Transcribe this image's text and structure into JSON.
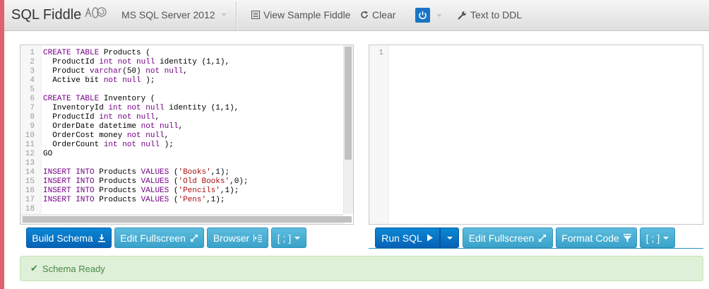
{
  "app": {
    "title": "SQL Fiddle"
  },
  "navbar": {
    "db_select": "MS SQL Server 2012",
    "view_sample": "View Sample Fiddle",
    "clear": "Clear",
    "text_to_ddl": "Text to DDL"
  },
  "schema_editor": {
    "lines": [
      {
        "n": "1",
        "parts": [
          [
            "kw",
            "CREATE TABLE "
          ],
          [
            "t",
            "Products ("
          ]
        ]
      },
      {
        "n": "2",
        "parts": [
          [
            "t",
            "  ProductId "
          ],
          [
            "kw",
            "int not null "
          ],
          [
            "t",
            "identity (1,1),"
          ]
        ]
      },
      {
        "n": "3",
        "parts": [
          [
            "t",
            "  Product "
          ],
          [
            "kw",
            "varchar"
          ],
          [
            "t",
            "(50) "
          ],
          [
            "kw",
            "not null"
          ],
          [
            "t",
            ","
          ]
        ]
      },
      {
        "n": "4",
        "parts": [
          [
            "t",
            "  Active bit "
          ],
          [
            "kw",
            "not null"
          ],
          [
            "t",
            " );"
          ]
        ]
      },
      {
        "n": "5",
        "parts": [
          [
            "t",
            ""
          ]
        ]
      },
      {
        "n": "6",
        "parts": [
          [
            "kw",
            "CREATE TABLE "
          ],
          [
            "t",
            "Inventory ("
          ]
        ]
      },
      {
        "n": "7",
        "parts": [
          [
            "t",
            "  InventoryId "
          ],
          [
            "kw",
            "int not null "
          ],
          [
            "t",
            "identity (1,1),"
          ]
        ]
      },
      {
        "n": "8",
        "parts": [
          [
            "t",
            "  ProductId "
          ],
          [
            "kw",
            "int not null"
          ],
          [
            "t",
            ","
          ]
        ]
      },
      {
        "n": "9",
        "parts": [
          [
            "t",
            "  OrderDate datetime "
          ],
          [
            "kw",
            "not null"
          ],
          [
            "t",
            ","
          ]
        ]
      },
      {
        "n": "10",
        "parts": [
          [
            "t",
            "  OrderCost money "
          ],
          [
            "kw",
            "not null"
          ],
          [
            "t",
            ","
          ]
        ]
      },
      {
        "n": "11",
        "parts": [
          [
            "t",
            "  OrderCount "
          ],
          [
            "kw",
            "int not null"
          ],
          [
            "t",
            " );"
          ]
        ]
      },
      {
        "n": "12",
        "parts": [
          [
            "t",
            "GO"
          ]
        ]
      },
      {
        "n": "13",
        "parts": [
          [
            "t",
            ""
          ]
        ]
      },
      {
        "n": "14",
        "parts": [
          [
            "kw",
            "INSERT INTO "
          ],
          [
            "t",
            "Products "
          ],
          [
            "kw",
            "VALUES "
          ],
          [
            "t",
            "("
          ],
          [
            "str",
            "'Books'"
          ],
          [
            "t",
            ",1);"
          ]
        ]
      },
      {
        "n": "15",
        "parts": [
          [
            "kw",
            "INSERT INTO "
          ],
          [
            "t",
            "Products "
          ],
          [
            "kw",
            "VALUES "
          ],
          [
            "t",
            "("
          ],
          [
            "str",
            "'Old Books'"
          ],
          [
            "t",
            ",0);"
          ]
        ]
      },
      {
        "n": "16",
        "parts": [
          [
            "kw",
            "INSERT INTO "
          ],
          [
            "t",
            "Products "
          ],
          [
            "kw",
            "VALUES "
          ],
          [
            "t",
            "("
          ],
          [
            "str",
            "'Pencils'"
          ],
          [
            "t",
            ",1);"
          ]
        ]
      },
      {
        "n": "17",
        "parts": [
          [
            "kw",
            "INSERT INTO "
          ],
          [
            "t",
            "Products "
          ],
          [
            "kw",
            "VALUES "
          ],
          [
            "t",
            "("
          ],
          [
            "str",
            "'Pens'"
          ],
          [
            "t",
            ",1);"
          ]
        ]
      },
      {
        "n": "18",
        "parts": [
          [
            "t",
            ""
          ]
        ]
      }
    ]
  },
  "query_editor": {
    "lines": [
      {
        "n": "1",
        "parts": [
          [
            "t",
            ""
          ]
        ]
      }
    ]
  },
  "schema_buttons": {
    "build": "Build Schema",
    "edit_fullscreen": "Edit Fullscreen",
    "browser": "Browser",
    "terminator": "[ ; ]"
  },
  "query_buttons": {
    "run": "Run SQL",
    "edit_fullscreen": "Edit Fullscreen",
    "format": "Format Code",
    "terminator": "[ ; ]"
  },
  "status": {
    "message": "Schema Ready"
  },
  "colors": {
    "primary": "#0662b6",
    "info": "#3aa2c9",
    "success_bg": "#dff0d8",
    "success_text": "#468847"
  }
}
